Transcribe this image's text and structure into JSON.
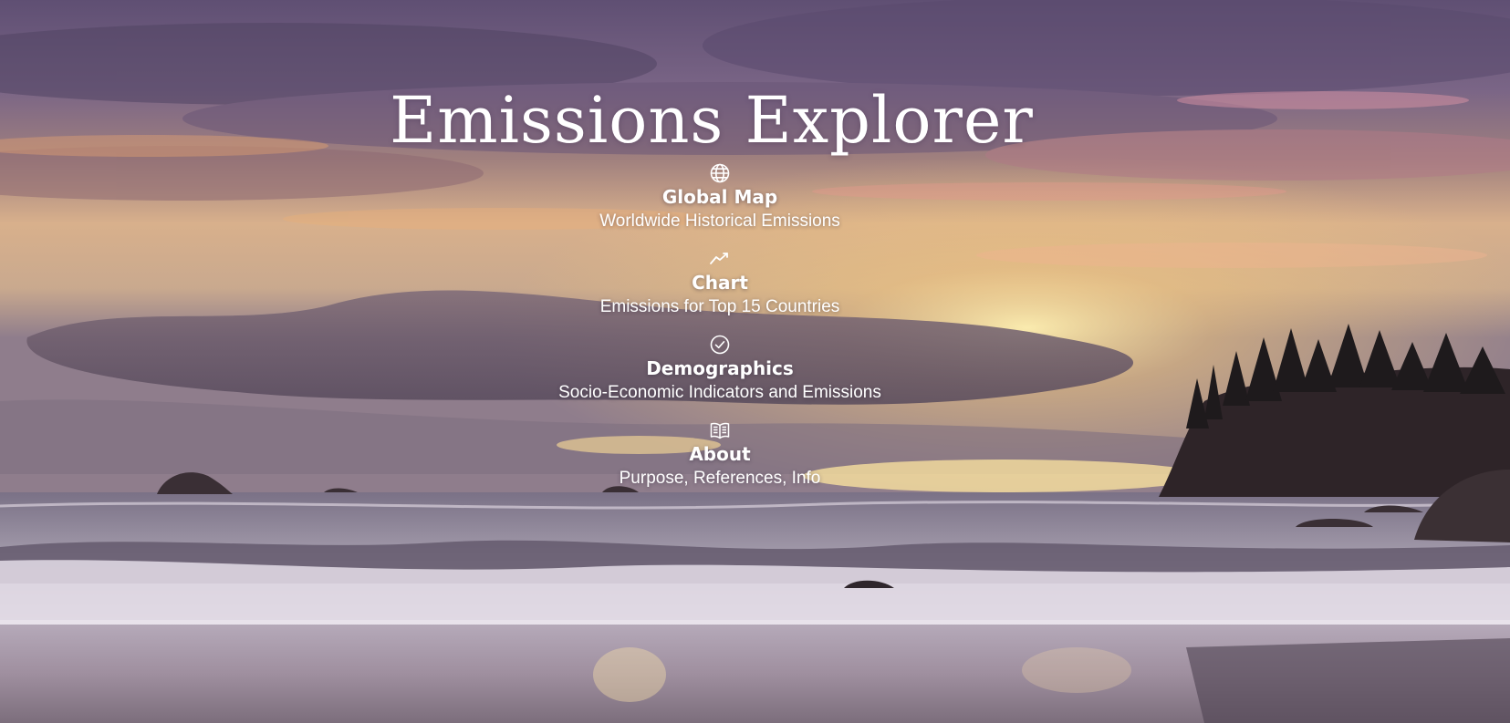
{
  "page": {
    "title": "Emissions Explorer"
  },
  "nav": {
    "items": [
      {
        "icon": "globe-icon",
        "label": "Global Map",
        "description": "Worldwide Historical Emissions"
      },
      {
        "icon": "line-chart-icon",
        "label": "Chart",
        "description": "Emissions for Top 15 Countries"
      },
      {
        "icon": "check-circle-icon",
        "label": "Demographics",
        "description": "Socio-Economic Indicators and Emissions"
      },
      {
        "icon": "open-book-icon",
        "label": "About",
        "description": "Purpose, References, Info"
      }
    ]
  },
  "colors": {
    "text": "#ffffff",
    "sky_top": "#6e5a82",
    "sky_glow": "#f2c98f",
    "sea": "#6c6478",
    "sand": "#b2a6b6"
  }
}
